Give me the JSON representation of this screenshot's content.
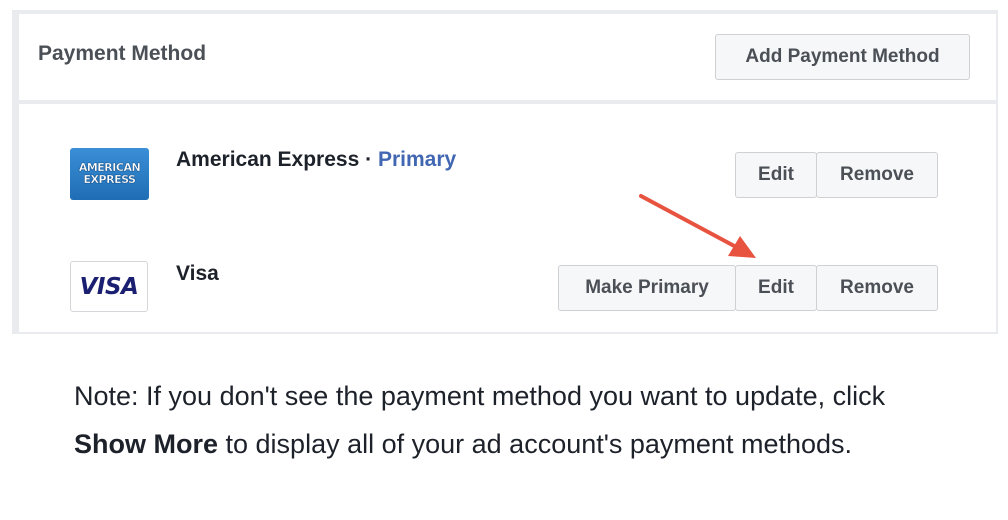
{
  "header": {
    "title": "Payment Method",
    "add_button_label": "Add Payment Method"
  },
  "methods": [
    {
      "name": "American Express",
      "separator": " · ",
      "status": "Primary",
      "logo_text": [
        "AMERICAN",
        "EXPRESS"
      ],
      "edit_label": "Edit",
      "remove_label": "Remove"
    },
    {
      "name": "Visa",
      "logo_text": "VISA",
      "make_primary_label": "Make Primary",
      "edit_label": "Edit",
      "remove_label": "Remove"
    }
  ],
  "note": {
    "before": "Note: If you don't see the payment method you want to update, click ",
    "bold": "Show More",
    "after": " to display all of your ad account's payment methods."
  },
  "colors": {
    "primary_link": "#4267b2",
    "annotation_arrow": "#e8533f"
  }
}
